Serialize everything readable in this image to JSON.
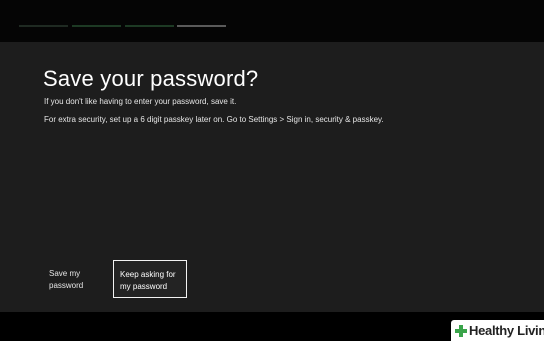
{
  "colors": {
    "background": "#1d1d1d",
    "topbar": "#050505",
    "progress_active": "#2e3a2e",
    "progress_current": "#6b6b6b",
    "logo_cross": "#3aa44a"
  },
  "progress": {
    "total_steps": 4,
    "current_step": 4
  },
  "dialog": {
    "title": "Save your password?",
    "line1": "If you don't like having to enter your password, save it.",
    "line2": "For extra security, set up a 6 digit passkey later on. Go to Settings > Sign in, security & passkey."
  },
  "buttons": {
    "save": {
      "line1": "Save my",
      "line2": "password"
    },
    "keep": {
      "line1": "Keep asking for",
      "line2": "my password"
    }
  },
  "watermark": {
    "text": "Healthy Living",
    "icon": "plus-cross-icon"
  }
}
